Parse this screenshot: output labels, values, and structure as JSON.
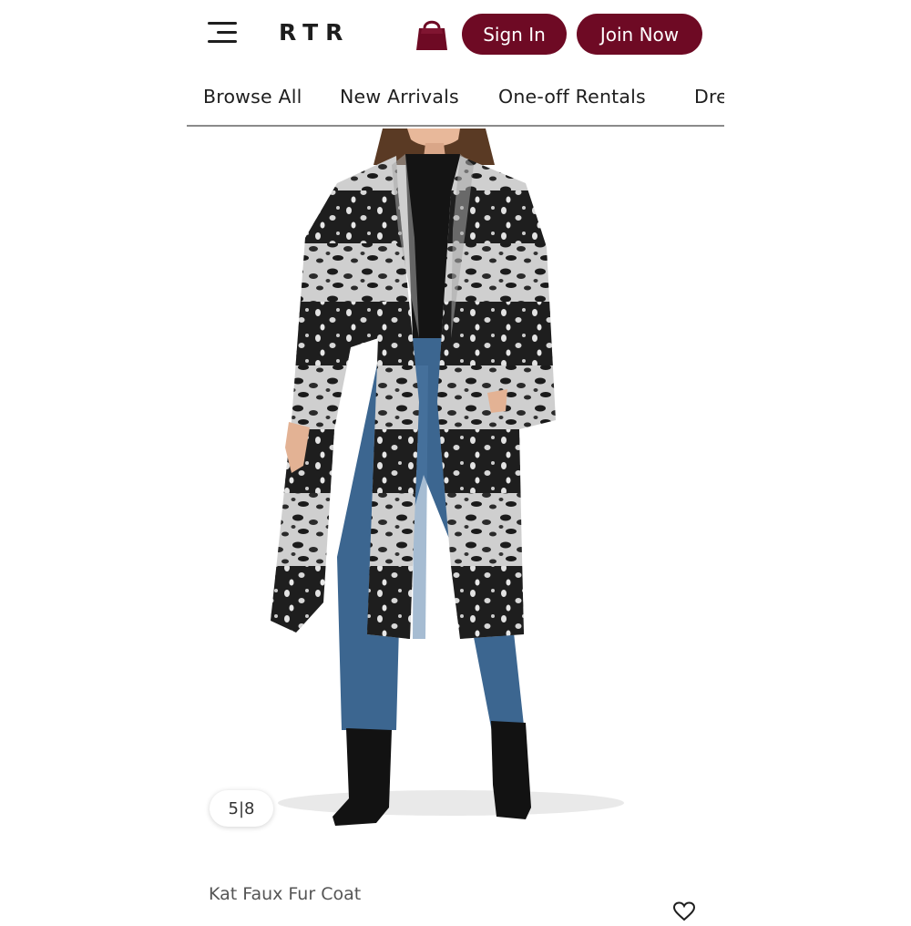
{
  "header": {
    "logo": "RTR",
    "menu_icon": "hamburger-menu-icon",
    "bag_icon": "shopping-bag-icon",
    "sign_in_label": "Sign In",
    "join_now_label": "Join Now",
    "button_color": "#6e0a24"
  },
  "nav": {
    "items": [
      "Browse All",
      "New Arrivals",
      "One-off Rentals",
      "Dre"
    ]
  },
  "gallery": {
    "counter": "5|8"
  },
  "product": {
    "name": "Kat Faux Fur Coat",
    "favorite_icon": "heart-icon"
  }
}
